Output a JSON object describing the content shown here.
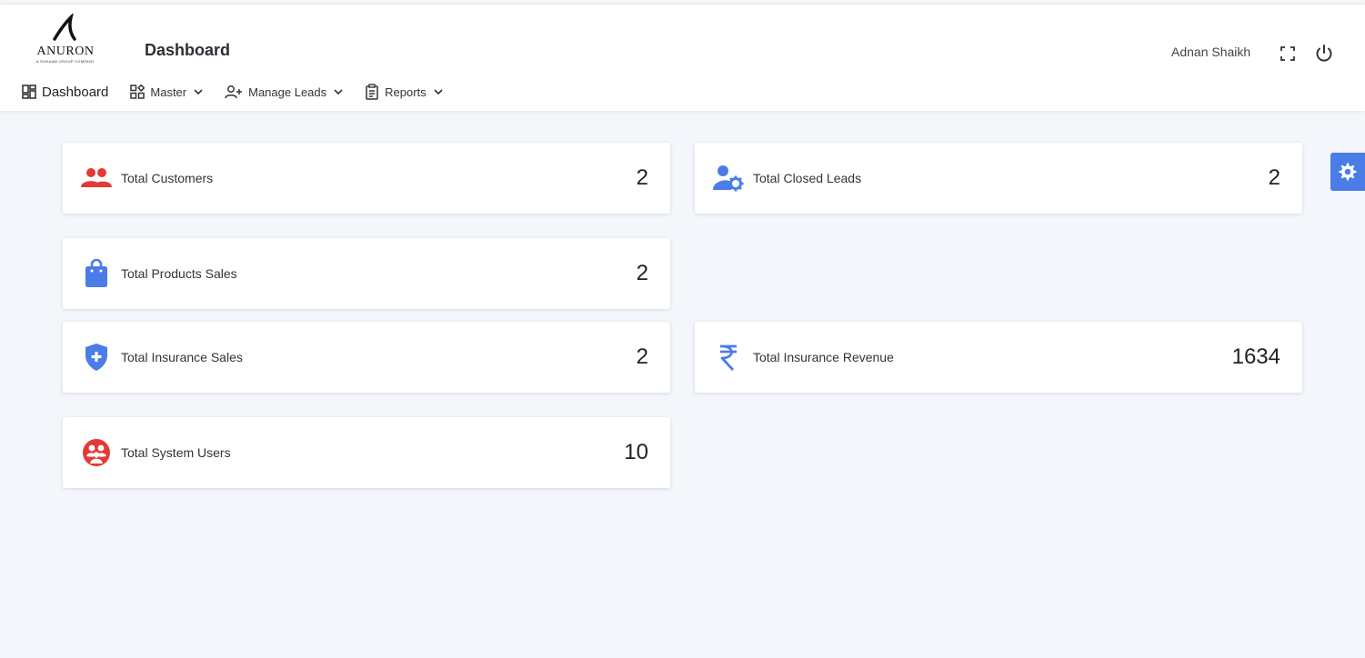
{
  "brand": {
    "name": "ANURON",
    "tagline": "A SOHAAM GROUP COMPANY",
    "logo_icon": "stylized-n-logo-icon"
  },
  "header": {
    "title": "Dashboard",
    "user_name": "Adnan Shaikh",
    "fullscreen_icon": "fullscreen-icon",
    "power_icon": "power-icon"
  },
  "nav": {
    "items": [
      {
        "label": "Dashboard",
        "icon": "dashboard-grid-icon",
        "dropdown": false
      },
      {
        "label": "Master",
        "icon": "apps-icon",
        "dropdown": true
      },
      {
        "label": "Manage Leads",
        "icon": "user-add-icon",
        "dropdown": true
      },
      {
        "label": "Reports",
        "icon": "clipboard-icon",
        "dropdown": true
      }
    ]
  },
  "cards": [
    {
      "label": "Total Customers",
      "value": "2",
      "icon": "people-icon",
      "color": "#e53935"
    },
    {
      "label": "Total Closed Leads",
      "value": "2",
      "icon": "user-gear-icon",
      "color": "#4a7de8"
    },
    {
      "label": "Total Products Sales",
      "value": "2",
      "icon": "shopping-bag-icon",
      "color": "#4a7de8"
    },
    {
      "label": "Total Insurance Sales",
      "value": "2",
      "icon": "shield-plus-icon",
      "color": "#4a7de8"
    },
    {
      "label": "Total Insurance Revenue",
      "value": "1634",
      "icon": "rupee-icon",
      "color": "#4a7de8"
    },
    {
      "label": "Total System Users",
      "value": "10",
      "icon": "users-circle-icon",
      "color": "#e53935"
    }
  ],
  "settings_icon": "gear-icon",
  "colors": {
    "accent": "#4a7de8",
    "danger": "#e53935",
    "background": "#f3f6fa"
  }
}
